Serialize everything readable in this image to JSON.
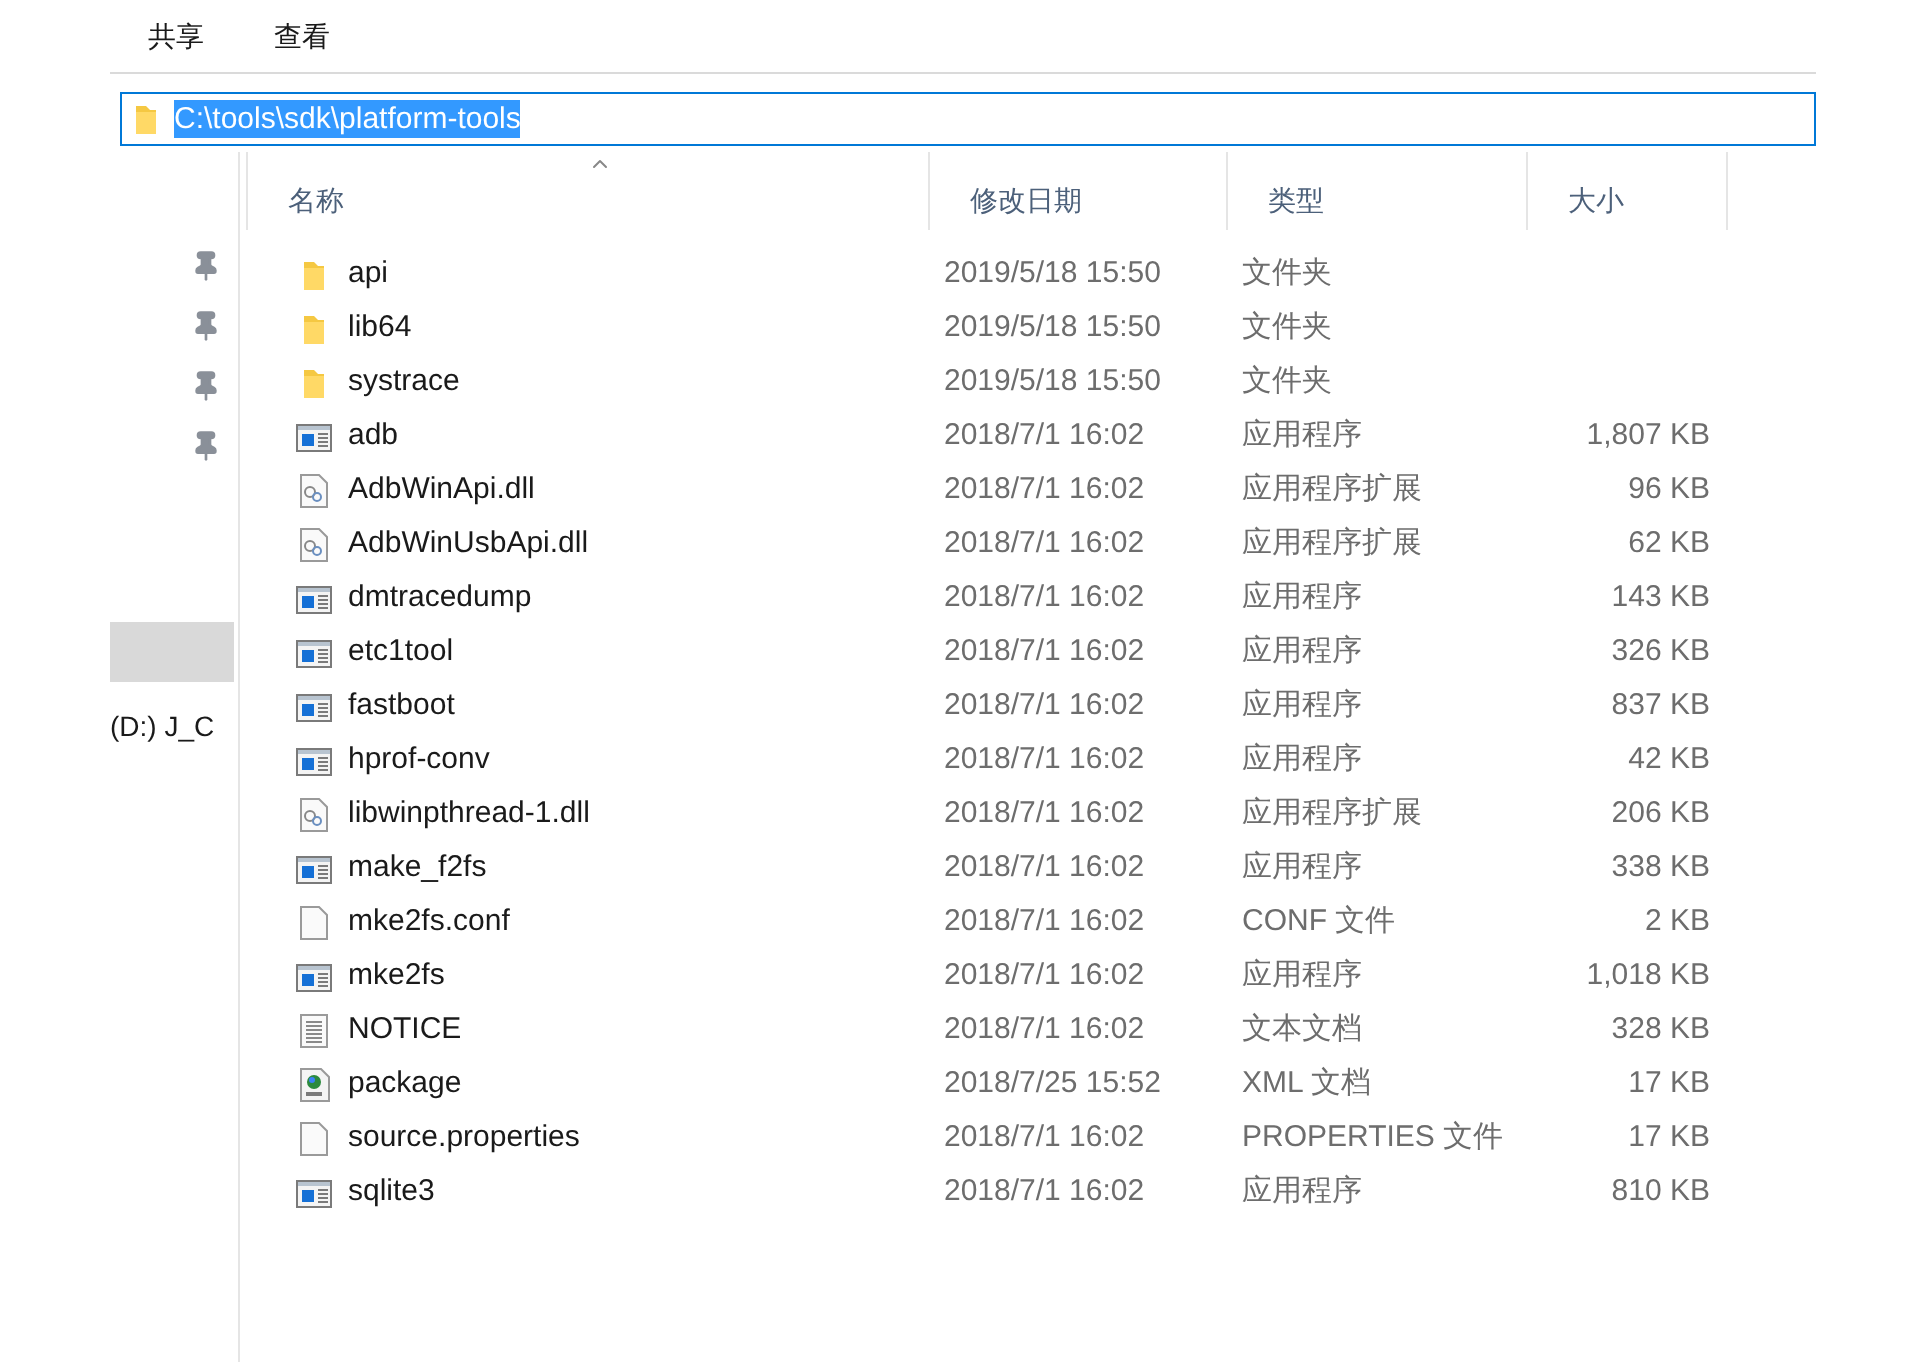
{
  "ribbon_tabs": [
    {
      "label": "共享"
    },
    {
      "label": "查看"
    }
  ],
  "address_bar": {
    "path": "C:\\tools\\sdk\\platform-tools",
    "selected": true
  },
  "navigation_pane": {
    "items": [
      {
        "pinned": true
      },
      {
        "pinned": true
      },
      {
        "pinned": true
      },
      {
        "pinned": true
      }
    ],
    "drive_label": "(D:) J_C"
  },
  "table": {
    "columns": [
      {
        "label": "名称",
        "sorted": true
      },
      {
        "label": "修改日期",
        "sorted": false
      },
      {
        "label": "类型",
        "sorted": false
      },
      {
        "label": "大小",
        "sorted": false
      }
    ],
    "rows": [
      {
        "kind": "folder",
        "name": "api",
        "date": "2019/5/18 15:50",
        "type": "文件夹"
      },
      {
        "kind": "folder",
        "name": "lib64",
        "date": "2019/5/18 15:50",
        "type": "文件夹"
      },
      {
        "kind": "folder",
        "name": "systrace",
        "date": "2019/5/18 15:50",
        "type": "文件夹"
      },
      {
        "kind": "exe",
        "name": "adb",
        "date": "2018/7/1 16:02",
        "type": "应用程序",
        "size": "1,807 KB"
      },
      {
        "kind": "dll",
        "name": "AdbWinApi.dll",
        "date": "2018/7/1 16:02",
        "type": "应用程序扩展",
        "size": "96 KB"
      },
      {
        "kind": "dll",
        "name": "AdbWinUsbApi.dll",
        "date": "2018/7/1 16:02",
        "type": "应用程序扩展",
        "size": "62 KB"
      },
      {
        "kind": "exe",
        "name": "dmtracedump",
        "date": "2018/7/1 16:02",
        "type": "应用程序",
        "size": "143 KB"
      },
      {
        "kind": "exe",
        "name": "etc1tool",
        "date": "2018/7/1 16:02",
        "type": "应用程序",
        "size": "326 KB"
      },
      {
        "kind": "exe",
        "name": "fastboot",
        "date": "2018/7/1 16:02",
        "type": "应用程序",
        "size": "837 KB"
      },
      {
        "kind": "exe",
        "name": "hprof-conv",
        "date": "2018/7/1 16:02",
        "type": "应用程序",
        "size": "42 KB"
      },
      {
        "kind": "dll",
        "name": "libwinpthread-1.dll",
        "date": "2018/7/1 16:02",
        "type": "应用程序扩展",
        "size": "206 KB"
      },
      {
        "kind": "exe",
        "name": "make_f2fs",
        "date": "2018/7/1 16:02",
        "type": "应用程序",
        "size": "338 KB"
      },
      {
        "kind": "file",
        "name": "mke2fs.conf",
        "date": "2018/7/1 16:02",
        "type": "CONF 文件",
        "size": "2 KB"
      },
      {
        "kind": "exe",
        "name": "mke2fs",
        "date": "2018/7/1 16:02",
        "type": "应用程序",
        "size": "1,018 KB"
      },
      {
        "kind": "text",
        "name": "NOTICE",
        "date": "2018/7/1 16:02",
        "type": "文本文档",
        "size": "328 KB"
      },
      {
        "kind": "xml",
        "name": "package",
        "date": "2018/7/25 15:52",
        "type": "XML 文档",
        "size": "17 KB"
      },
      {
        "kind": "file",
        "name": "source.properties",
        "date": "2018/7/1 16:02",
        "type": "PROPERTIES 文件",
        "size": "17 KB"
      },
      {
        "kind": "exe",
        "name": "sqlite3",
        "date": "2018/7/1 16:02",
        "type": "应用程序",
        "size": "810 KB"
      }
    ]
  }
}
